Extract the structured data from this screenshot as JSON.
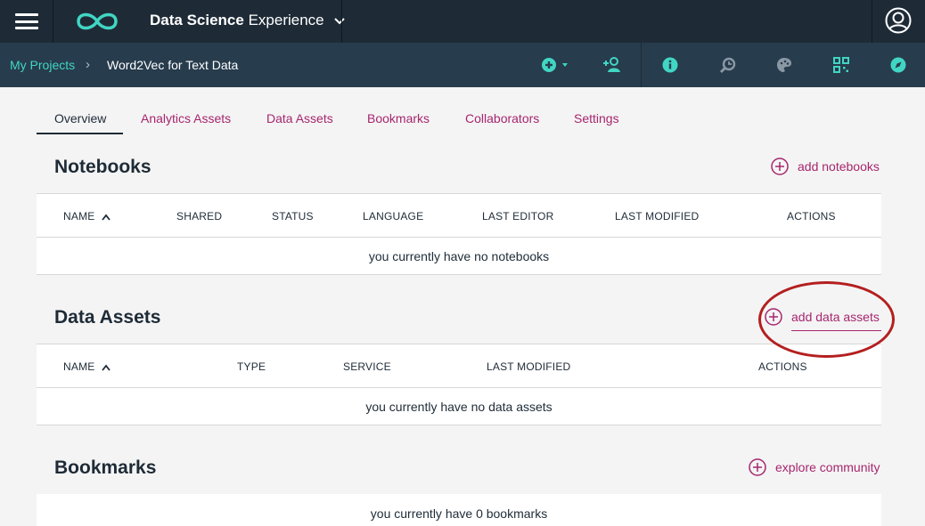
{
  "header": {
    "app_title_bold": "Data Science",
    "app_title_rest": " Experience",
    "icons": [
      "menu-icon",
      "infinity-logo-icon",
      "chevron-down-icon",
      "user-avatar-icon"
    ]
  },
  "subheader": {
    "breadcrumb_root": "My Projects",
    "breadcrumb_separator": "›",
    "breadcrumb_current": "Word2Vec for Text Data",
    "tools": [
      "add-icon",
      "add-collaborator-icon",
      "info-icon",
      "find-replace-icon",
      "palette-icon",
      "qr-grid-icon",
      "compass-icon"
    ]
  },
  "tabs": [
    {
      "label": "Overview",
      "active": true
    },
    {
      "label": "Analytics Assets",
      "active": false
    },
    {
      "label": "Data Assets",
      "active": false
    },
    {
      "label": "Bookmarks",
      "active": false
    },
    {
      "label": "Collaborators",
      "active": false
    },
    {
      "label": "Settings",
      "active": false
    }
  ],
  "notebooks": {
    "title": "Notebooks",
    "action": "add notebooks",
    "columns": [
      "NAME",
      "SHARED",
      "STATUS",
      "LANGUAGE",
      "LAST EDITOR",
      "LAST MODIFIED",
      "ACTIONS"
    ],
    "empty_text": "you currently have no notebooks"
  },
  "data_assets": {
    "title": "Data Assets",
    "action": "add data assets",
    "columns": [
      "NAME",
      "TYPE",
      "SERVICE",
      "LAST MODIFIED",
      "ACTIONS"
    ],
    "empty_text": "you currently have no data assets"
  },
  "bookmarks": {
    "title": "Bookmarks",
    "action": "explore community",
    "empty_text": "you currently have 0 bookmarks"
  },
  "colors": {
    "accent": "#a6266e",
    "teal": "#41d6c3",
    "topbar": "#1e2b37",
    "subbar": "#273c4d",
    "annotation": "#b41f1f"
  }
}
